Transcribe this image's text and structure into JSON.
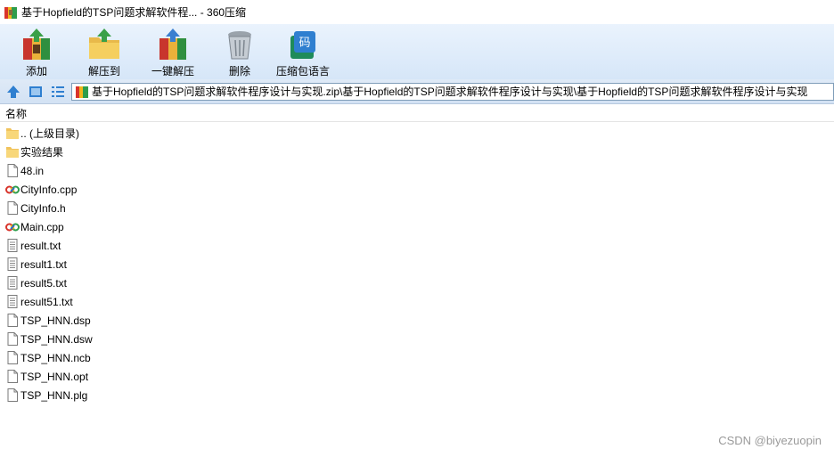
{
  "window": {
    "title": "基于Hopfield的TSP问题求解软件程... - 360压缩"
  },
  "toolbar": {
    "add_label": "添加",
    "extract_label": "解压到",
    "one_click_label": "一键解压",
    "delete_label": "删除",
    "comment_label": "压缩包语言",
    "comment_icon_text": "码"
  },
  "address": {
    "path": "基于Hopfield的TSP问题求解软件程序设计与实现.zip\\基于Hopfield的TSP问题求解软件程序设计与实现\\基于Hopfield的TSP问题求解软件程序设计与实现"
  },
  "list": {
    "header_name": "名称",
    "rows": [
      {
        "name": ".. (上级目录)",
        "icon": "folder-icon"
      },
      {
        "name": "实验结果",
        "icon": "folder-icon"
      },
      {
        "name": "48.in",
        "icon": "file-icon"
      },
      {
        "name": "CityInfo.cpp",
        "icon": "cpp-file-icon"
      },
      {
        "name": "CityInfo.h",
        "icon": "file-icon"
      },
      {
        "name": "Main.cpp",
        "icon": "cpp-file-icon"
      },
      {
        "name": "result.txt",
        "icon": "text-file-icon"
      },
      {
        "name": "result1.txt",
        "icon": "text-file-icon"
      },
      {
        "name": "result5.txt",
        "icon": "text-file-icon"
      },
      {
        "name": "result51.txt",
        "icon": "text-file-icon"
      },
      {
        "name": "TSP_HNN.dsp",
        "icon": "file-icon"
      },
      {
        "name": "TSP_HNN.dsw",
        "icon": "file-icon"
      },
      {
        "name": "TSP_HNN.ncb",
        "icon": "file-icon"
      },
      {
        "name": "TSP_HNN.opt",
        "icon": "file-icon"
      },
      {
        "name": "TSP_HNN.plg",
        "icon": "file-icon"
      }
    ]
  },
  "watermark": "CSDN @biyezuopin"
}
